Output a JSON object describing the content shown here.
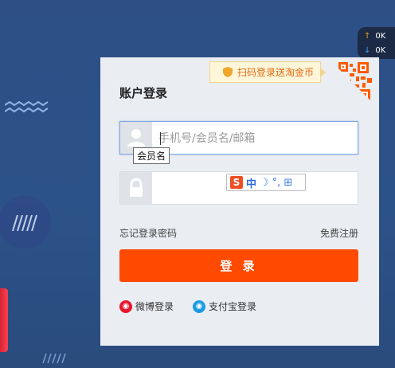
{
  "speed": {
    "up": "0K",
    "down": "0K"
  },
  "login": {
    "title": "账户登录",
    "qr_tip": "扫码登录送淘金币",
    "username_placeholder": "手机号/会员名/邮箱",
    "tooltip": "会员名",
    "password_value": "",
    "forgot": "忘记登录密码",
    "register": "免费注册",
    "button": "登 录",
    "weibo": "微博登录",
    "alipay": "支付宝登录"
  },
  "ime": {
    "s": "S",
    "lang": "中"
  },
  "colors": {
    "accent": "#ff4a00",
    "panel": "#eaedf2",
    "background": "#2c5389"
  },
  "icons": [
    "user-icon",
    "lock-icon",
    "shield-icon",
    "qr-code-icon",
    "weibo-icon",
    "alipay-icon",
    "upload-arrow-icon",
    "download-arrow-icon"
  ]
}
